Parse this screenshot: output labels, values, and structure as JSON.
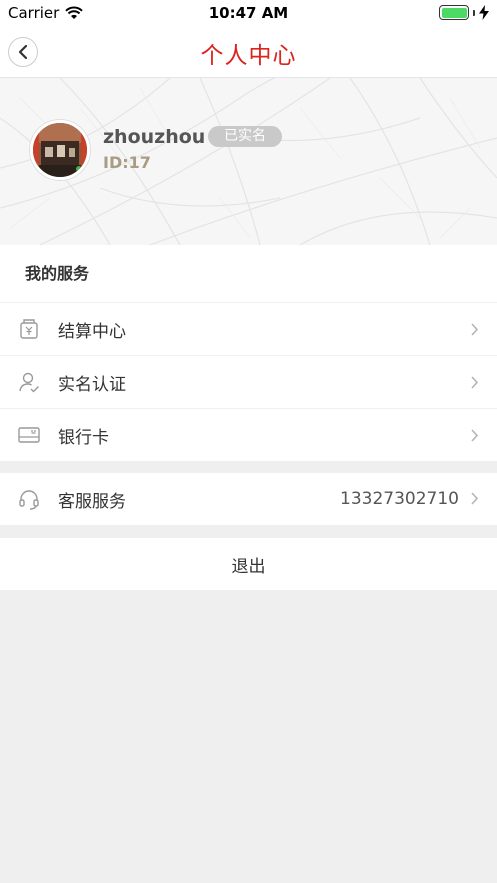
{
  "status_bar": {
    "carrier": "Carrier",
    "time": "10:47 AM"
  },
  "nav": {
    "title": "个人中心",
    "back_icon": "chevron-left-icon"
  },
  "profile": {
    "username": "zhouzhou",
    "verified_label": "已实名",
    "id_text": "ID:17"
  },
  "services": {
    "section_title": "我的服务",
    "items": [
      {
        "label": "结算中心",
        "icon": "wallet-yen-icon"
      },
      {
        "label": "实名认证",
        "icon": "user-check-icon"
      },
      {
        "label": "银行卡",
        "icon": "bank-card-icon"
      }
    ]
  },
  "customer_service": {
    "label": "客服服务",
    "phone": "13327302710",
    "icon": "headset-icon"
  },
  "logout": {
    "label": "退出"
  },
  "colors": {
    "accent": "#d9251d",
    "id_color": "#a89c82",
    "battery": "#4cd964"
  }
}
